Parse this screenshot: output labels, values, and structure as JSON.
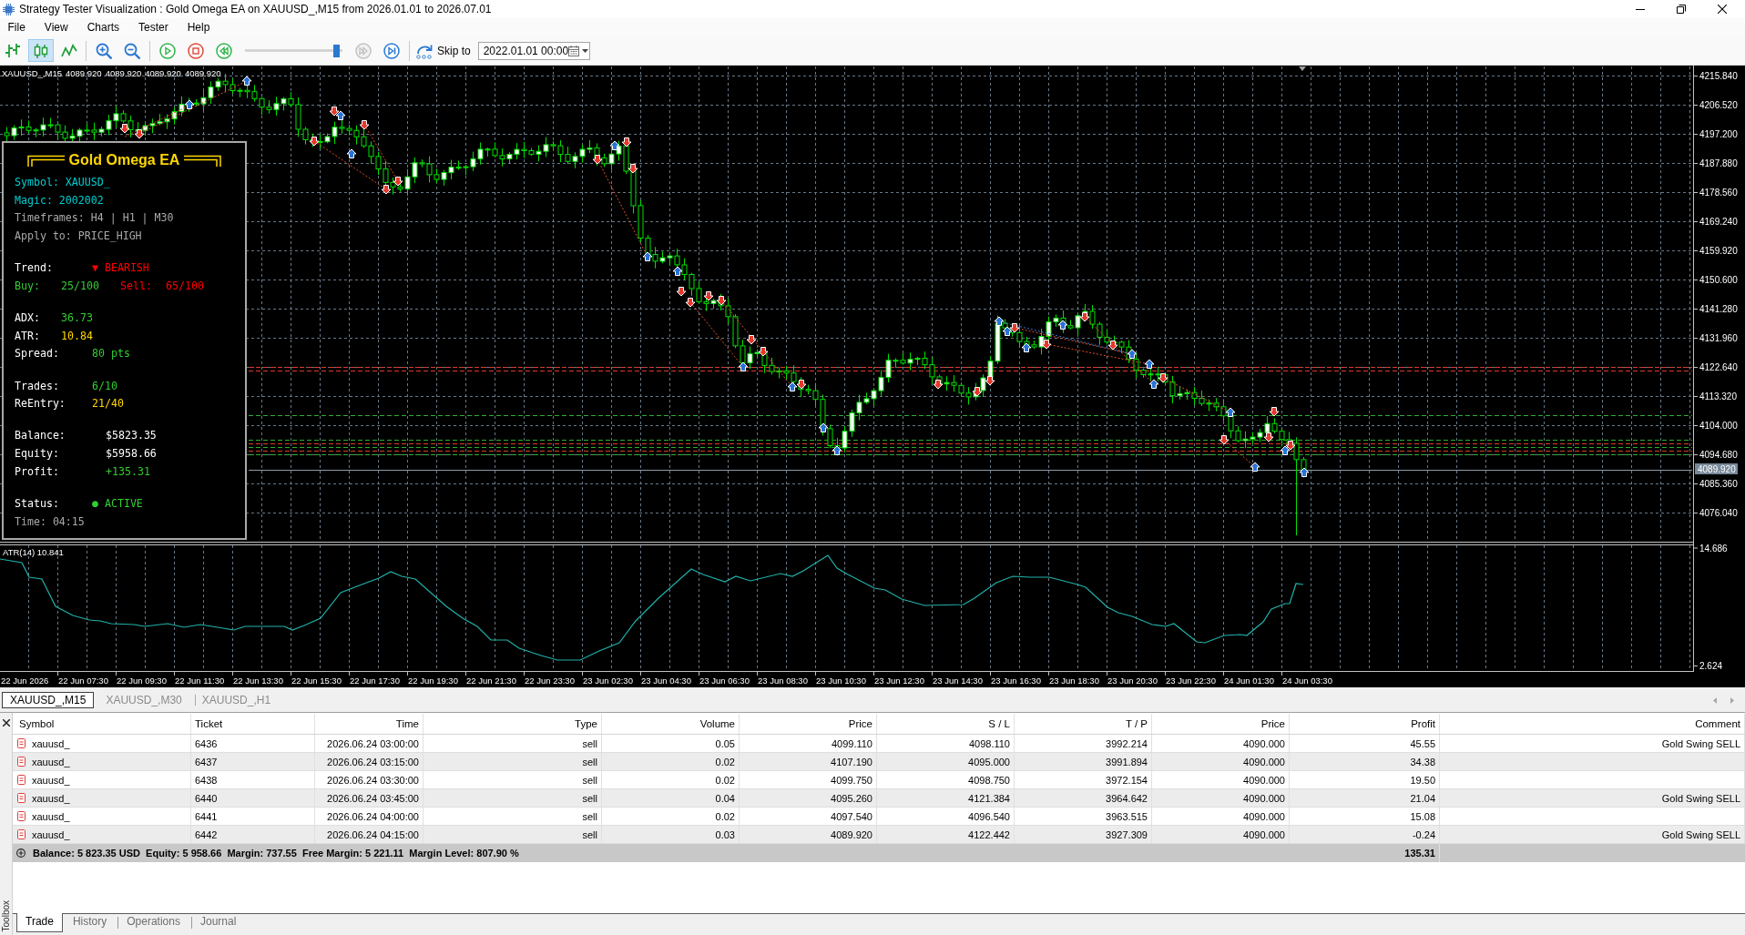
{
  "window": {
    "title": "Strategy Tester Visualization : Gold Omega EA on XAUUSD_,M15 from 2026.01.01 to 2026.07.01"
  },
  "menu": [
    "File",
    "View",
    "Charts",
    "Tester",
    "Help"
  ],
  "toolbar": {
    "chart_modes": [
      {
        "kind": "bars",
        "selected": false
      },
      {
        "kind": "candles",
        "selected": true
      },
      {
        "kind": "line",
        "selected": false
      }
    ],
    "zoom": [
      {
        "kind": "in"
      },
      {
        "kind": "out"
      }
    ],
    "playback": [
      {
        "kind": "play",
        "disabled": false
      },
      {
        "kind": "stop",
        "disabled": false
      },
      {
        "kind": "rewind",
        "disabled": false
      }
    ],
    "speed": {
      "level": 0.97
    },
    "stepping": [
      {
        "kind": "forward",
        "disabled": true
      },
      {
        "kind": "end",
        "disabled": false
      }
    ],
    "skip_to": {
      "label": "Skip to",
      "date": "2022.01.01 00:00"
    }
  },
  "chart": {
    "symbol": "XAUUSD_,M15",
    "ohlc": [
      "4089.920",
      "4089.920",
      "4089.920",
      "4089.920"
    ],
    "price_labels": [
      "4215.840",
      "4206.520",
      "4197.200",
      "4187.880",
      "4178.560",
      "4169.240",
      "4159.920",
      "4150.600",
      "4141.280",
      "4131.960",
      "4122.640",
      "4113.320",
      "4104.000",
      "4094.680",
      "4085.360",
      "4076.040"
    ],
    "current_price": "4089.920",
    "indicator": {
      "label": "ATR(14) 10.841",
      "scale_labels": [
        "14.686",
        "2.624"
      ]
    },
    "time_labels": [
      "22 Jun 2026",
      "22 Jun 07:30",
      "22 Jun 09:30",
      "22 Jun 11:30",
      "22 Jun 13:30",
      "22 Jun 15:30",
      "22 Jun 17:30",
      "22 Jun 19:30",
      "22 Jun 21:30",
      "22 Jun 23:30",
      "23 Jun 02:30",
      "23 Jun 04:30",
      "23 Jun 06:30",
      "23 Jun 08:30",
      "23 Jun 10:30",
      "23 Jun 12:30",
      "23 Jun 14:30",
      "23 Jun 16:30",
      "23 Jun 18:30",
      "23 Jun 20:30",
      "23 Jun 22:30",
      "24 Jun 01:30",
      "24 Jun 03:30"
    ]
  },
  "info_panel": {
    "title": "Gold Omega EA",
    "sections": [
      {
        "rows": [
          {
            "kind": "text",
            "cells": [
              {
                "text": "Symbol: XAUUSD_",
                "color": "#00ced1"
              }
            ]
          },
          {
            "kind": "text",
            "cells": [
              {
                "text": "Magic: 2002002",
                "color": "#00ced1"
              }
            ]
          },
          {
            "kind": "text",
            "cells": [
              {
                "text": "Timeframes: H4 | H1 | M30",
                "color": "#a9a9a9"
              }
            ]
          },
          {
            "kind": "text",
            "cells": [
              {
                "text": "Apply to: PRICE_HIGH",
                "color": "#a9a9a9"
              }
            ]
          }
        ]
      },
      {
        "rows": [
          {
            "kind": "medium",
            "cells": [
              {
                "text": "Trend:",
                "color": "#ffffff"
              },
              {
                "text": "▼ BEARISH",
                "color": "#ff0000"
              }
            ]
          },
          {
            "kind": "score",
            "cells": [
              {
                "text": "Buy:",
                "color": "#32cd32"
              },
              {
                "text": "25/100",
                "color": "#32cd32"
              },
              {
                "text": "Sell:",
                "color": "#ff0000"
              },
              {
                "text": "65/100",
                "color": "#ff0000"
              }
            ]
          }
        ]
      },
      {
        "rows": [
          {
            "kind": "short",
            "cells": [
              {
                "text": "ADX:",
                "color": "#ffffff"
              },
              {
                "text": "36.73",
                "color": "#32cd32"
              }
            ]
          },
          {
            "kind": "short",
            "cells": [
              {
                "text": "ATR:",
                "color": "#ffffff"
              },
              {
                "text": "10.84",
                "color": "#ffd700"
              }
            ]
          },
          {
            "kind": "medium",
            "cells": [
              {
                "text": "Spread:",
                "color": "#ffffff"
              },
              {
                "text": "80 pts",
                "color": "#32cd32"
              }
            ]
          }
        ]
      },
      {
        "rows": [
          {
            "kind": "medium",
            "cells": [
              {
                "text": "Trades:",
                "color": "#ffffff"
              },
              {
                "text": "6/10",
                "color": "#32cd32"
              }
            ]
          },
          {
            "kind": "medium",
            "cells": [
              {
                "text": "ReEntry:",
                "color": "#ffffff"
              },
              {
                "text": "21/40",
                "color": "#ffd700"
              }
            ]
          }
        ]
      },
      {
        "rows": [
          {
            "kind": "wide",
            "cells": [
              {
                "text": "Balance:",
                "color": "#ffffff"
              },
              {
                "text": "$5823.35",
                "color": "#ffffff"
              }
            ]
          },
          {
            "kind": "wide",
            "cells": [
              {
                "text": "Equity:",
                "color": "#ffffff"
              },
              {
                "text": "$5958.66",
                "color": "#ffffff"
              }
            ]
          },
          {
            "kind": "wide",
            "cells": [
              {
                "text": "Profit:",
                "color": "#ffffff"
              },
              {
                "text": "+135.31",
                "color": "#32cd32"
              }
            ]
          }
        ]
      },
      {
        "rows": [
          {
            "kind": "medium",
            "cells": [
              {
                "text": "Status:",
                "color": "#ffffff"
              },
              {
                "text": "● ACTIVE",
                "color": "#32cd32"
              }
            ]
          },
          {
            "kind": "text",
            "cells": [
              {
                "text": "Time: 04:15",
                "color": "#a9a9a9"
              }
            ]
          }
        ]
      }
    ]
  },
  "symbol_tabs": [
    {
      "label": "XAUUSD_,M15",
      "selected": true
    },
    {
      "label": "XAUUSD_,M30",
      "selected": false
    },
    {
      "label": "XAUUSD_,H1",
      "selected": false
    }
  ],
  "toolbox": {
    "label": "Toolbox",
    "columns": [
      "Symbol",
      "Ticket",
      "Time",
      "Type",
      "Volume",
      "Price",
      "S / L",
      "T / P",
      "Price",
      "Profit",
      "Comment"
    ],
    "rows": [
      [
        "xauusd_",
        "6436",
        "2026.06.24 03:00:00",
        "sell",
        "0.05",
        "4099.110",
        "4098.110",
        "3992.214",
        "4090.000",
        "45.55",
        "Gold Swing SELL"
      ],
      [
        "xauusd_",
        "6437",
        "2026.06.24 03:15:00",
        "sell",
        "0.02",
        "4107.190",
        "4095.000",
        "3991.894",
        "4090.000",
        "34.38"
      ],
      [
        "xauusd_",
        "6438",
        "2026.06.24 03:30:00",
        "sell",
        "0.02",
        "4099.750",
        "4098.750",
        "3972.154",
        "4090.000",
        "19.50"
      ],
      [
        "xauusd_",
        "6440",
        "2026.06.24 03:45:00",
        "sell",
        "0.04",
        "4095.260",
        "4121.384",
        "3964.642",
        "4090.000",
        "21.04",
        "Gold Swing SELL"
      ],
      [
        "xauusd_",
        "6441",
        "2026.06.24 04:00:00",
        "sell",
        "0.02",
        "4097.540",
        "4096.540",
        "3963.515",
        "4090.000",
        "15.08"
      ],
      [
        "xauusd_",
        "6442",
        "2026.06.24 04:15:00",
        "sell",
        "0.03",
        "4089.920",
        "4122.442",
        "3927.309",
        "4090.000",
        "-0.24",
        "Gold Swing SELL"
      ]
    ],
    "summary": {
      "text": "Balance: 5 823.35 USD  Equity: 5 958.66  Margin: 737.55  Free Margin: 5 221.11  Margin Level: 807.90 %",
      "profit": "135.31"
    },
    "tabs": [
      {
        "label": "Trade",
        "selected": true
      },
      {
        "label": "History",
        "selected": false
      },
      {
        "label": "Operations",
        "selected": false
      },
      {
        "label": "Journal",
        "selected": false
      }
    ]
  }
}
